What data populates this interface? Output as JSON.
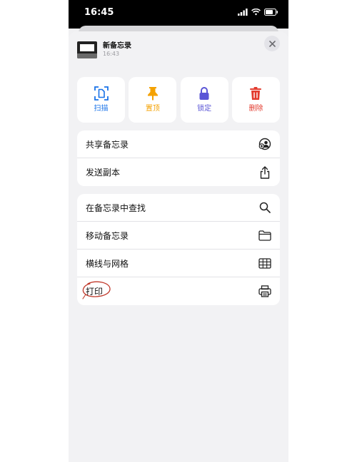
{
  "status_bar": {
    "time": "16:45"
  },
  "note": {
    "title": "新备忘录",
    "time": "16:43"
  },
  "actions": [
    {
      "label": "扫描",
      "icon": "scan-icon",
      "color": "#1a73e8"
    },
    {
      "label": "置顶",
      "icon": "pin-icon",
      "color": "#f4a100"
    },
    {
      "label": "锁定",
      "icon": "lock-icon",
      "color": "#5a55d6"
    },
    {
      "label": "删除",
      "icon": "trash-icon",
      "color": "#e33b2e"
    }
  ],
  "group1": [
    {
      "label": "共享备忘录",
      "icon": "share-note-icon"
    },
    {
      "label": "发送副本",
      "icon": "share-icon"
    }
  ],
  "group2": [
    {
      "label": "在备忘录中查找",
      "icon": "search-icon"
    },
    {
      "label": "移动备忘录",
      "icon": "folder-icon"
    },
    {
      "label": "横线与网格",
      "icon": "grid-icon"
    },
    {
      "label": "打印",
      "icon": "printer-icon"
    }
  ]
}
